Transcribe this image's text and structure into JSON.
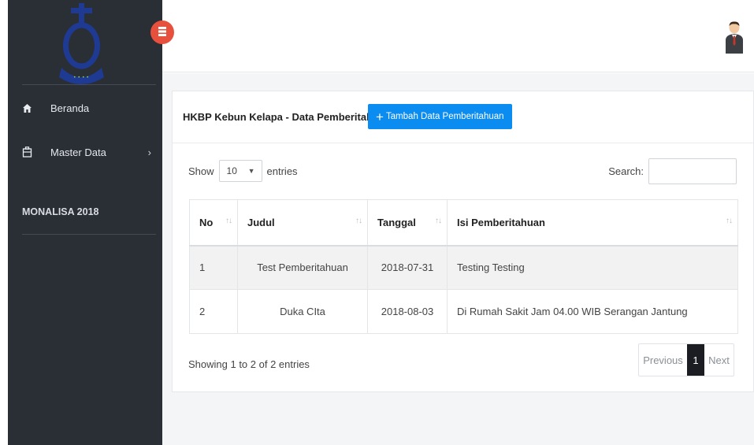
{
  "sidebar": {
    "menu": [
      {
        "label": "Beranda",
        "icon": "home-icon"
      },
      {
        "label": "Master Data",
        "icon": "briefcase-icon"
      }
    ],
    "section_title": "MONALISA 2018"
  },
  "card": {
    "title": "HKBP Kebun Kelapa - Data Pemberitahuan",
    "add_button": "Tambah Data Pemberitahuan",
    "add_button_icon": "+"
  },
  "table_controls": {
    "show_label": "Show",
    "entries_label": "entries",
    "length_value": "10",
    "search_label": "Search:"
  },
  "table": {
    "columns": [
      "No",
      "Judul",
      "Tanggal",
      "Isi Pemberitahuan"
    ],
    "rows": [
      [
        "1",
        "Test Pemberitahuan",
        "2018-07-31",
        "Testing Testing"
      ],
      [
        "2",
        "Duka CIta",
        "2018-08-03",
        "Di Rumah Sakit Jam 04.00 WIB Serangan Jantung"
      ]
    ]
  },
  "footer": {
    "info": "Showing 1 to 2 of 2 entries",
    "previous": "Previous",
    "page": "1",
    "next": "Next"
  },
  "colors": {
    "sidebar_bg": "#2a2e35",
    "accent_button": "#0b8cf0",
    "toggle_button": "#e8503e",
    "active_page": "#1b1d22"
  }
}
